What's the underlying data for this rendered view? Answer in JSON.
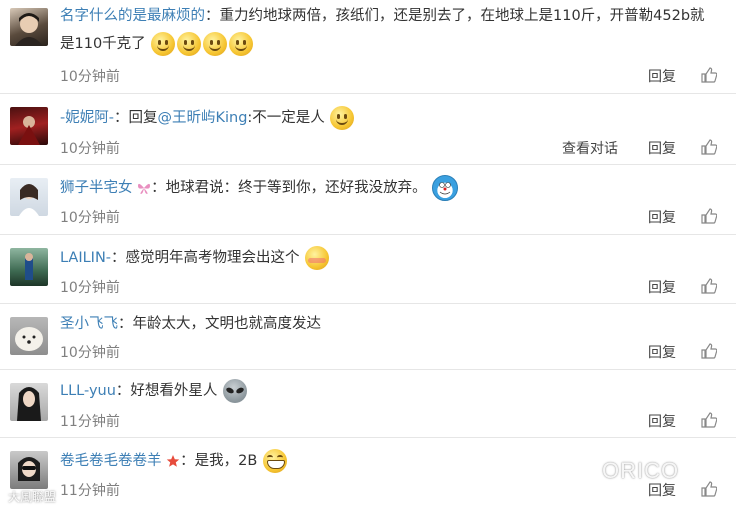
{
  "actions": {
    "reply": "回复",
    "view_dialog": "查看对话"
  },
  "comments": [
    {
      "name": "名字什么的是最麻烦的",
      "text_before": "：重力约地球两倍，孩纸们，还是别去了，在地球上是110斤，开普勒452b就",
      "text_line2": "是110千克了",
      "time": "10分钟前",
      "emoji": "smile-icon"
    },
    {
      "name": "-妮妮阿-",
      "reply_prefix": "：回复",
      "mention": "@王昕屿King",
      "text": ":不一定是人",
      "time": "10分钟前",
      "emoji": "smile-icon"
    },
    {
      "name": "狮子半宅女",
      "text": "：地球君说：终于等到你，还好我没放弃。",
      "time": "10分钟前",
      "emoji": "doraemon-icon"
    },
    {
      "name": "LAILIN-",
      "text": "：感觉明年高考物理会出这个",
      "time": "10分钟前",
      "emoji": "blush-icon"
    },
    {
      "name": "圣小飞飞",
      "text": "：年龄太大，文明也就高度发达",
      "time": "10分钟前"
    },
    {
      "name": "LLL-yuu",
      "text": "：好想看外星人",
      "time": "11分钟前",
      "emoji": "alien-icon"
    },
    {
      "name": "卷毛卷毛卷卷羊",
      "text": "：是我，2B",
      "time": "11分钟前",
      "emoji": "grin-icon"
    }
  ],
  "watermark": {
    "brand": "ORICO",
    "corner": "大風聯盟"
  },
  "colors": {
    "name_link": "#3d7fb5",
    "text": "#333333",
    "time": "#808080",
    "divider": "#e6e6e6"
  }
}
